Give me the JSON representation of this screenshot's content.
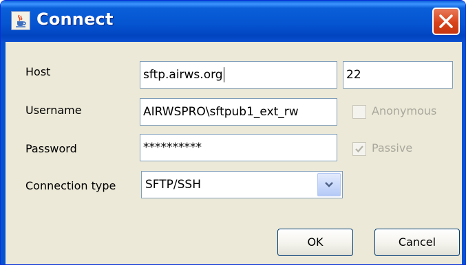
{
  "window": {
    "title": "Connect",
    "app_icon": "java-cup-icon",
    "close_icon": "close-icon"
  },
  "form": {
    "host_label": "Host",
    "host_value": "sftp.airws.org",
    "port_value": "22",
    "username_label": "Username",
    "username_value": "AIRWSPRO\\sftpub1_ext_rw",
    "anonymous_label": "Anonymous",
    "anonymous_checked": false,
    "anonymous_enabled": false,
    "password_label": "Password",
    "password_value": "**********",
    "passive_label": "Passive",
    "passive_checked": true,
    "passive_enabled": false,
    "connection_type_label": "Connection type",
    "connection_type_value": "SFTP/SSH"
  },
  "buttons": {
    "ok_label": "OK",
    "cancel_label": "Cancel"
  },
  "colors": {
    "titlebar": "#0553d0",
    "close_button": "#d9431b",
    "dialog_background": "#ece9d8",
    "field_border": "#7f9db9",
    "disabled_text": "#a8a79b"
  }
}
